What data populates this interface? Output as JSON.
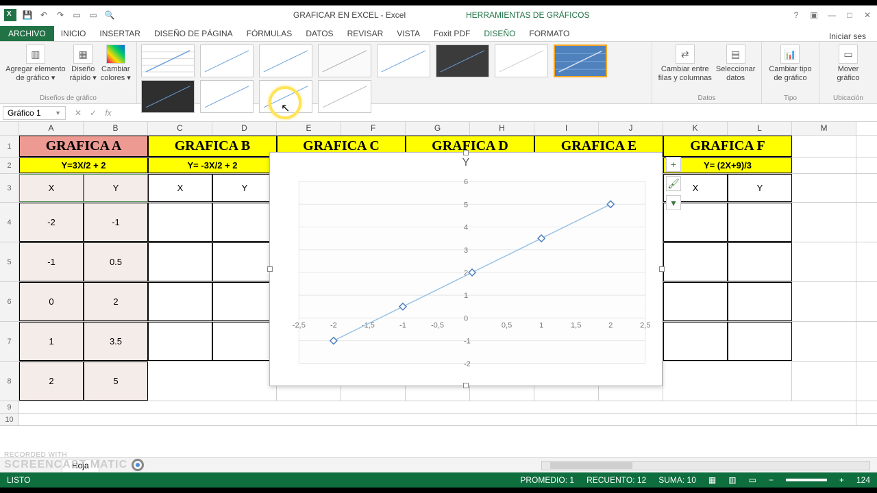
{
  "title": "GRAFICAR EN EXCEL - Excel",
  "chart_tools_label": "HERRAMIENTAS DE GRÁFICOS",
  "session": "Iniciar ses",
  "tabs": {
    "file": "ARCHIVO",
    "home": "INICIO",
    "insert": "INSERTAR",
    "layout": "DISEÑO DE PÁGINA",
    "formulas": "FÓRMULAS",
    "data": "DATOS",
    "review": "REVISAR",
    "view": "VISTA",
    "foxit": "Foxit PDF",
    "design": "DISEÑO",
    "format": "FORMATO"
  },
  "ribbon": {
    "add_element": "Agregar elemento\nde gráfico ▾",
    "quick_layout": "Diseño\nrápido ▾",
    "change_colors": "Cambiar\ncolores ▾",
    "group_layouts": "Diseños de gráfico",
    "switch": "Cambiar entre\nfilas y columnas",
    "select_data": "Seleccionar\ndatos",
    "group_data": "Datos",
    "change_type": "Cambiar tipo\nde gráfico",
    "group_type": "Tipo",
    "move_chart": "Mover\ngráfico",
    "group_location": "Ubicación"
  },
  "namebox": "Gráfico 1",
  "columns": [
    "A",
    "B",
    "C",
    "D",
    "E",
    "F",
    "G",
    "H",
    "I",
    "J",
    "K",
    "L",
    "M"
  ],
  "row_headers": {
    "r1": "GRAFICA A",
    "r1b": "GRAFICA B",
    "r1c": "GRAFICA C",
    "r1d": "GRAFICA D",
    "r1e": "GRAFICA E",
    "r1f": "GRAFICA F"
  },
  "formulas": {
    "a": "Y=3X/2 + 2",
    "b": "Y= -3X/2  + 2",
    "f": "Y= (2X+9)/3"
  },
  "labels": {
    "x": "X",
    "y": "Y"
  },
  "dataA": {
    "x": [
      "-2",
      "-1",
      "0",
      "1",
      "2"
    ],
    "y": [
      "-1",
      "0.5",
      "2",
      "3.5",
      "5"
    ]
  },
  "chart_data": {
    "type": "scatter",
    "title": "Y",
    "x": [
      -2,
      -1,
      0,
      1,
      2
    ],
    "y": [
      -1,
      0.5,
      2,
      3.5,
      5
    ],
    "xlim": [
      -2.5,
      2.5
    ],
    "ylim": [
      -2,
      6
    ],
    "xticks": [
      -2.5,
      -2,
      -1.5,
      -1,
      -0.5,
      0,
      0.5,
      1,
      1.5,
      2,
      2.5
    ],
    "yticks": [
      -2,
      -1,
      0,
      1,
      2,
      3,
      4,
      5,
      6
    ],
    "xlabel": "",
    "ylabel": ""
  },
  "status": {
    "ready": "LISTO",
    "avg": "PROMEDIO: 1",
    "count": "RECUENTO: 12",
    "sum": "SUMA: 10",
    "zoom": "124"
  },
  "sheet": "Hoja",
  "watermark1": "RECORDED WITH",
  "watermark2": "SCREENCAST  MATIC"
}
